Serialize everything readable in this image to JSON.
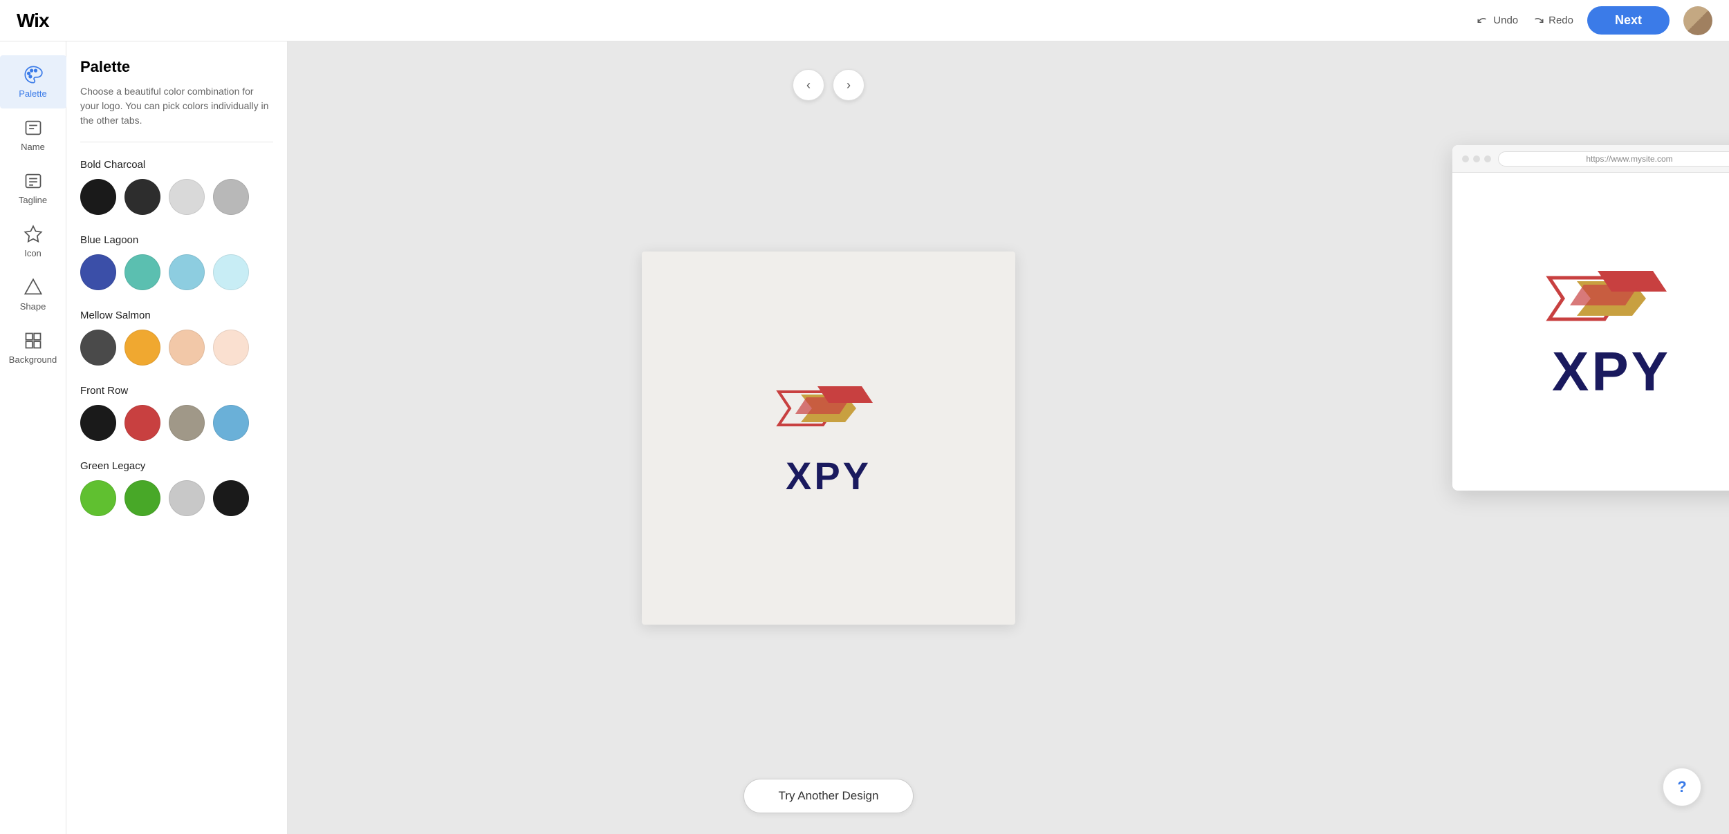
{
  "header": {
    "logo": "Wix",
    "undo_label": "Undo",
    "redo_label": "Redo",
    "next_label": "Next"
  },
  "sidebar": {
    "items": [
      {
        "id": "palette",
        "label": "Palette",
        "active": true
      },
      {
        "id": "name",
        "label": "Name",
        "active": false
      },
      {
        "id": "tagline",
        "label": "Tagline",
        "active": false
      },
      {
        "id": "icon",
        "label": "Icon",
        "active": false
      },
      {
        "id": "shape",
        "label": "Shape",
        "active": false
      },
      {
        "id": "background",
        "label": "Background",
        "active": false
      }
    ]
  },
  "palette_panel": {
    "title": "Palette",
    "description": "Choose a beautiful color combination for your logo. You can pick colors individually in the other tabs.",
    "groups": [
      {
        "name": "Bold Charcoal",
        "swatches": [
          "#1a1a1a",
          "#2d2d2d",
          "#d9d9d9",
          "#b8b8b8"
        ]
      },
      {
        "name": "Blue Lagoon",
        "swatches": [
          "#3b4fa8",
          "#5bbfb0",
          "#8dcde0",
          "#c8edf5"
        ]
      },
      {
        "name": "Mellow Salmon",
        "swatches": [
          "#4a4a4a",
          "#f0a830",
          "#f2c8a8",
          "#fae0d0"
        ]
      },
      {
        "name": "Front Row",
        "swatches": [
          "#1a1a1a",
          "#c84040",
          "#a09888",
          "#6ab0d8"
        ]
      },
      {
        "name": "Green Legacy",
        "swatches": [
          "#60c030",
          "#48a828",
          "#c8c8c8",
          "#1a1a1a"
        ]
      }
    ]
  },
  "canvas": {
    "logo_text": "XPY",
    "try_another_label": "Try Another Design"
  },
  "browser_mockup": {
    "url": "https://www.mysite.com",
    "logo_text": "XPY"
  },
  "help_btn_label": "?"
}
